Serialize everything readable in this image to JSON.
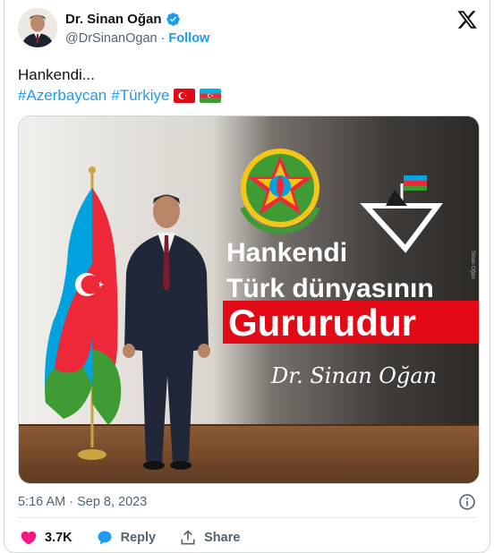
{
  "author": {
    "display_name": "Dr. Sinan Oğan",
    "handle": "@DrSinanOgan",
    "separator": "·",
    "follow_label": "Follow"
  },
  "tweet": {
    "text": "Hankendi...",
    "hashtags": [
      "#Azerbaycan",
      "#Türkiye"
    ],
    "flags": [
      "turkey-flag",
      "azerbaijan-flag"
    ]
  },
  "media": {
    "headline_1": "Hankendi",
    "headline_2": "Türk dünyasının",
    "headline_3": "Gururudur",
    "signature": "Dr. Sinan Oğan",
    "side_tag": "Sinan Oğan"
  },
  "meta": {
    "timestamp": "5:16 AM · Sep 8, 2023"
  },
  "actions": {
    "like_count": "3.7K",
    "reply_label": "Reply",
    "share_label": "Share"
  },
  "colors": {
    "accent": "#1d9bf0",
    "like": "#f91880",
    "text": "#0f1419",
    "muted": "#536471",
    "banner_red": "#e30a17"
  }
}
